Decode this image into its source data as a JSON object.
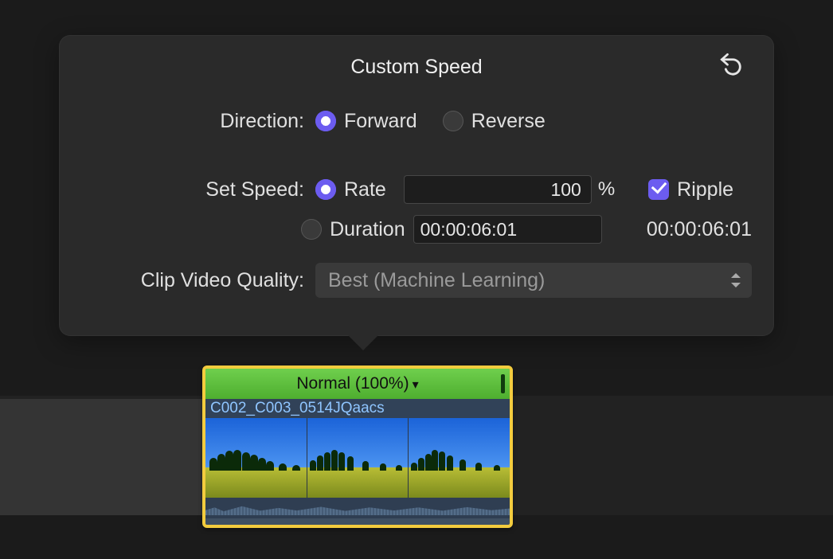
{
  "popover": {
    "title": "Custom Speed",
    "direction": {
      "label": "Direction:",
      "forward": "Forward",
      "reverse": "Reverse",
      "selected": "forward"
    },
    "setSpeed": {
      "label": "Set Speed:",
      "rateLabel": "Rate",
      "rateValue": "100",
      "pct": "%",
      "durationLabel": "Duration",
      "durationValue": "00:00:06:01",
      "durationStatic": "00:00:06:01",
      "rippleLabel": "Ripple",
      "rippleChecked": true,
      "selected": "rate"
    },
    "quality": {
      "label": "Clip Video Quality:",
      "value": "Best (Machine Learning)"
    }
  },
  "clip": {
    "speedLabel": "Normal (100%)",
    "name": "C002_C003_0514JQaacs"
  }
}
